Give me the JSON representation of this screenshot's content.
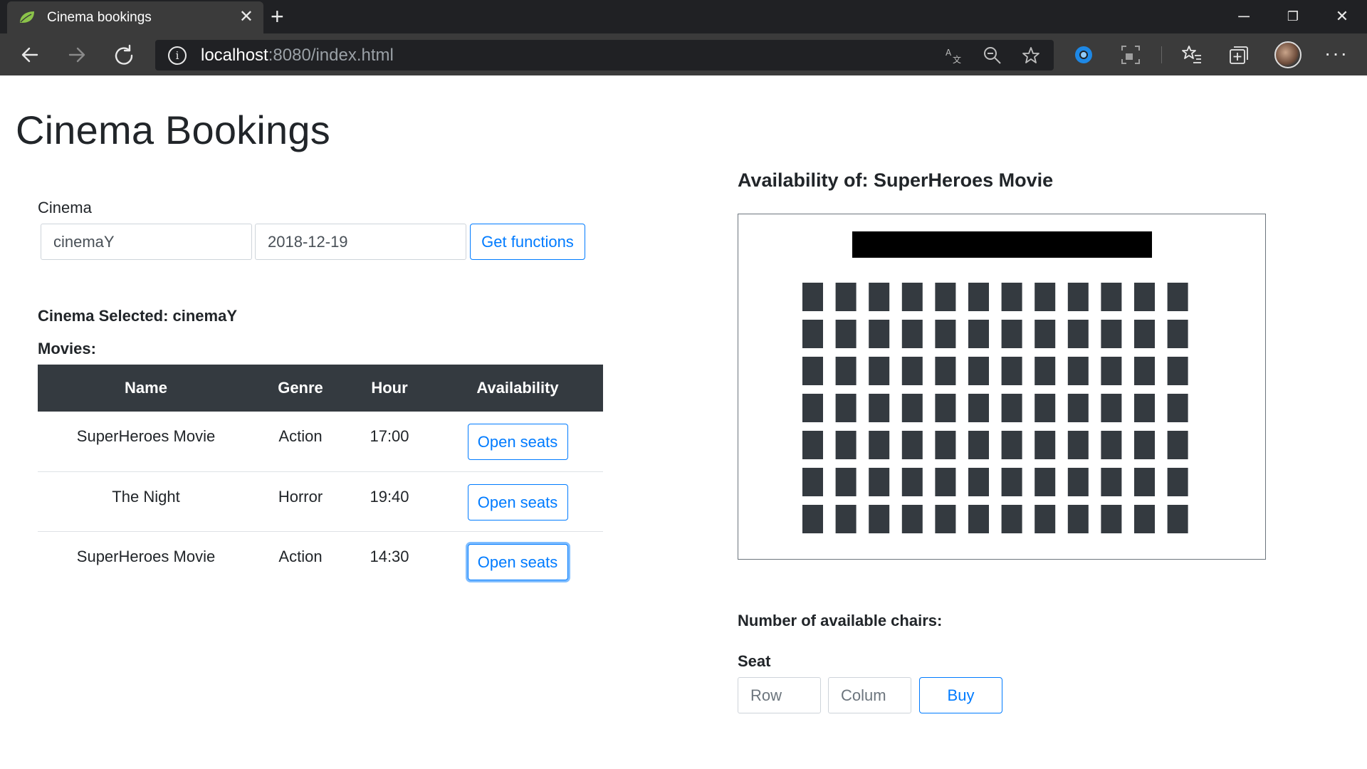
{
  "browser": {
    "tab_title": "Cinema bookings",
    "url_host": "localhost",
    "url_rest": ":8080/index.html"
  },
  "page": {
    "title": "Cinema Bookings",
    "cinema_label": "Cinema",
    "cinema_value": "cinemaY",
    "date_value": "2018-12-19",
    "get_functions_label": "Get functions",
    "cinema_selected_label": "Cinema Selected: cinemaY",
    "movies_label": "Movies:",
    "table": {
      "headers": [
        "Name",
        "Genre",
        "Hour",
        "Availability"
      ],
      "rows": [
        {
          "name": "SuperHeroes Movie",
          "genre": "Action",
          "hour": "17:00",
          "button": "Open seats"
        },
        {
          "name": "The Night",
          "genre": "Horror",
          "hour": "19:40",
          "button": "Open seats"
        },
        {
          "name": "SuperHeroes Movie",
          "genre": "Action",
          "hour": "14:30",
          "button": "Open seats"
        }
      ]
    },
    "availability_title": "Availability of: SuperHeroes Movie",
    "seat_grid": {
      "rows": 7,
      "columns": 12,
      "seat_color": "#343a40",
      "screen_color": "#000000"
    },
    "available_chairs_label": "Number of available chairs:",
    "seat_label": "Seat",
    "row_placeholder": "Row",
    "column_placeholder": "Colum",
    "buy_label": "Buy"
  },
  "colors": {
    "accent": "#007bff",
    "table_header": "#343a40",
    "chrome_dark": "#202124",
    "chrome_toolbar": "#3b3b3b"
  }
}
